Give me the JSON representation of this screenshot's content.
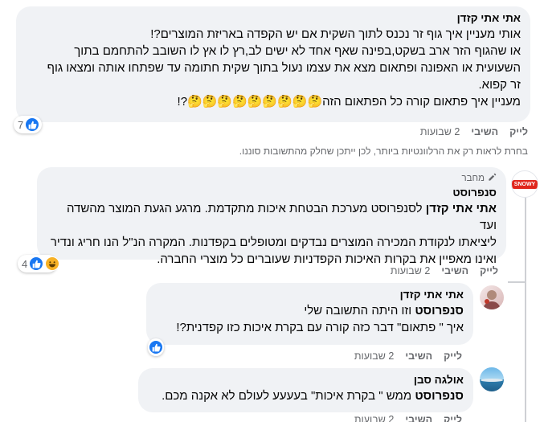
{
  "comment1": {
    "author": "אתי אתי קזדן",
    "line1": "אותי מעניין איך גוף זר נכנס לתוך השקית אם יש הקפדה באריזת המוצרים?!",
    "line2": "או שהגוף הזר ארב בשקט,בפינה שאף אחד לא ישים לב,רץ לו אץ לו השובב להתחמם בתוך",
    "line3": "השעועית או האפונה ופתאום מצא את עצמו נעול בתוך שקית חתומה עד שפתחו אותה ומצאו גוף",
    "line4": "זר קפוא.",
    "line5": "מעניין איך פתאום קורה כל הפתאום הזה🤔🤔🤔🤔🤔🤔🤔🤔🤔?!",
    "reaction_count": "7",
    "actions": {
      "like": "לייק",
      "reply": "השיבי",
      "time": "2 שבועות"
    }
  },
  "relevance_note": "בחרת לראות רק את הרלוונטיות ביותר, לכן ייתכן שחלק מהתשובות סוננו.",
  "comment2": {
    "badge": "מחבר",
    "author": "סנפרוסט",
    "mention": "אתי אתי קזדן",
    "line1_rest": " לסנפרוסט מערכת הבטחת איכות מתקדמת. מרגע הגעת המוצר מהשדה ועד",
    "line2": "ליציאתו לנקודת המכירה המוצרים נבדקים ומטופלים בקפדנות. המקרה הנ\"ל הנו חריג ונדיר",
    "line3": "ואינו מאפיין את בקרות האיכות הקפדניות שעוברים כל מוצרי החברה.",
    "reaction_count": "4",
    "avatar_text": "SNOWY",
    "actions": {
      "like": "לייק",
      "reply": "השיבי",
      "time": "2 שבועות"
    }
  },
  "reply1": {
    "author": "אתי אתי קזדן",
    "mention": "סנפרוסט",
    "line1_rest": " וזו היתה התשובה שלי",
    "line2": "איך \" פתאום\" דבר כזה קורה עם בקרת איכות כזו קפדנית?!",
    "actions": {
      "like": "לייק",
      "reply": "השיבי",
      "time": "2 שבועות"
    }
  },
  "reply2": {
    "author": "אולגה סבן",
    "mention": "סנפרוסט",
    "line1_rest": " ממש \" בקרת איכות\" בעעעע לעולם לא אקנה מכם.",
    "actions": {
      "like": "לייק",
      "reply": "השיבי",
      "time": "2 שבועות"
    }
  },
  "colors": {
    "like": "#1877f2",
    "bubble": "#f0f2f5",
    "meta": "#65676b",
    "brand": "#e0261c"
  }
}
